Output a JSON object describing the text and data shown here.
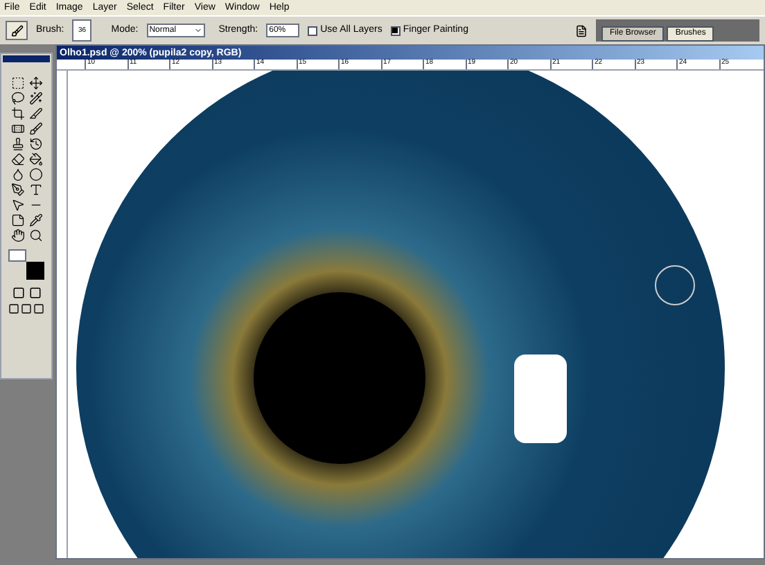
{
  "menu": [
    "File",
    "Edit",
    "Image",
    "Layer",
    "Select",
    "Filter",
    "View",
    "Window",
    "Help"
  ],
  "options_bar": {
    "brush_label": "Brush:",
    "brush_size": "36",
    "mode_label": "Mode:",
    "mode_value": "Normal",
    "strength_label": "Strength:",
    "strength_value": "60%",
    "checkboxes": [
      {
        "label": "Use All Layers",
        "checked": false
      },
      {
        "label": "Finger Painting",
        "checked": true
      }
    ]
  },
  "palette_tabs": [
    {
      "label": "File Browser",
      "selected": false
    },
    {
      "label": "Brushes",
      "selected": true
    }
  ],
  "document": {
    "title": "Olho1.psd @ 200% (pupila2 copy, RGB)",
    "ruler_ticks": [
      "10",
      "11",
      "12",
      "13",
      "14",
      "15",
      "16",
      "17",
      "18",
      "19",
      "20",
      "21",
      "22",
      "23",
      "24",
      "25"
    ]
  }
}
